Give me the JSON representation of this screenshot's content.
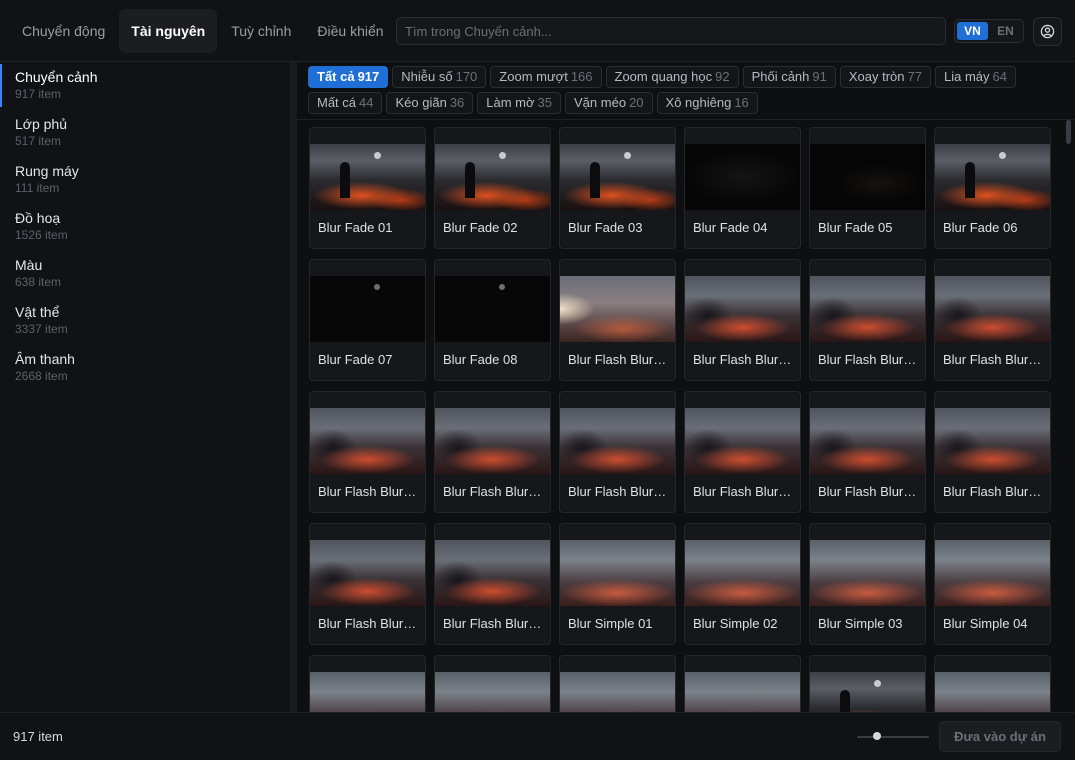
{
  "header": {
    "tabs": [
      {
        "label": "Chuyển động",
        "active": false
      },
      {
        "label": "Tài nguyên",
        "active": true
      },
      {
        "label": "Tuỳ chỉnh",
        "active": false
      },
      {
        "label": "Điều khiển",
        "active": false
      }
    ],
    "search_placeholder": "Tìm trong Chuyển cảnh...",
    "lang": {
      "vn": "VN",
      "en": "EN",
      "active": "VN"
    },
    "account_icon": "user-circle-icon"
  },
  "sidebar": {
    "items": [
      {
        "name": "Chuyển cảnh",
        "count": "917 item",
        "active": true
      },
      {
        "name": "Lớp phủ",
        "count": "517 item",
        "active": false
      },
      {
        "name": "Rung máy",
        "count": "111 item",
        "active": false
      },
      {
        "name": "Đồ hoạ",
        "count": "1526 item",
        "active": false
      },
      {
        "name": "Màu",
        "count": "638 item",
        "active": false
      },
      {
        "name": "Vật thể",
        "count": "3337 item",
        "active": false
      },
      {
        "name": "Âm thanh",
        "count": "2668 item",
        "active": false
      }
    ]
  },
  "chips": [
    {
      "label": "Tất cả",
      "count": "917",
      "active": true
    },
    {
      "label": "Nhiễu số",
      "count": "170"
    },
    {
      "label": "Zoom mượt",
      "count": "166"
    },
    {
      "label": "Zoom quang học",
      "count": "92"
    },
    {
      "label": "Phối cảnh",
      "count": "91"
    },
    {
      "label": "Xoay tròn",
      "count": "77"
    },
    {
      "label": "Lia máy",
      "count": "64"
    },
    {
      "label": "Mất cá",
      "count": "44"
    },
    {
      "label": "Kéo giãn",
      "count": "36"
    },
    {
      "label": "Làm mờ",
      "count": "35"
    },
    {
      "label": "Vặn méo",
      "count": "20"
    },
    {
      "label": "Xô nghiêng",
      "count": "16"
    }
  ],
  "grid": {
    "items": [
      {
        "label": "Blur Fade 01",
        "thumb": "scene"
      },
      {
        "label": "Blur Fade 02",
        "thumb": "scene"
      },
      {
        "label": "Blur Fade 03",
        "thumb": "scene"
      },
      {
        "label": "Blur Fade 04",
        "thumb": "dark"
      },
      {
        "label": "Blur Fade 05",
        "thumb": "dark2"
      },
      {
        "label": "Blur Fade 06",
        "thumb": "scene"
      },
      {
        "label": "Blur Fade 07",
        "thumb": "black"
      },
      {
        "label": "Blur Fade 08",
        "thumb": "black"
      },
      {
        "label": "Blur Flash Blur ...",
        "thumb": "flash"
      },
      {
        "label": "Blur Flash Blur ...",
        "thumb": "blur"
      },
      {
        "label": "Blur Flash Blur ...",
        "thumb": "blur"
      },
      {
        "label": "Blur Flash Blur ...",
        "thumb": "blur"
      },
      {
        "label": "Blur Flash Blur ...",
        "thumb": "blur"
      },
      {
        "label": "Blur Flash Blur ...",
        "thumb": "blur"
      },
      {
        "label": "Blur Flash Blur ...",
        "thumb": "blur"
      },
      {
        "label": "Blur Flash Blur ...",
        "thumb": "blur"
      },
      {
        "label": "Blur Flash Blur ...",
        "thumb": "blur"
      },
      {
        "label": "Blur Flash Blur ...",
        "thumb": "blur"
      },
      {
        "label": "Blur Flash Blur ...",
        "thumb": "blur"
      },
      {
        "label": "Blur Flash Blur ...",
        "thumb": "blur"
      },
      {
        "label": "Blur Simple 01",
        "thumb": "simple"
      },
      {
        "label": "Blur Simple 02",
        "thumb": "simple"
      },
      {
        "label": "Blur Simple 03",
        "thumb": "simple"
      },
      {
        "label": "Blur Simple 04",
        "thumb": "simple"
      },
      {
        "label": "",
        "thumb": "simple"
      },
      {
        "label": "",
        "thumb": "simple"
      },
      {
        "label": "",
        "thumb": "simple"
      },
      {
        "label": "",
        "thumb": "simple"
      },
      {
        "label": "",
        "thumb": "scene"
      },
      {
        "label": "",
        "thumb": "simple"
      }
    ]
  },
  "footer": {
    "count": "917 item",
    "add_button": "Đưa vào dự án",
    "zoom_level": 0.25
  },
  "colors": {
    "accent": "#1f6fd6",
    "background": "#0e0f11",
    "panel": "#111215"
  }
}
